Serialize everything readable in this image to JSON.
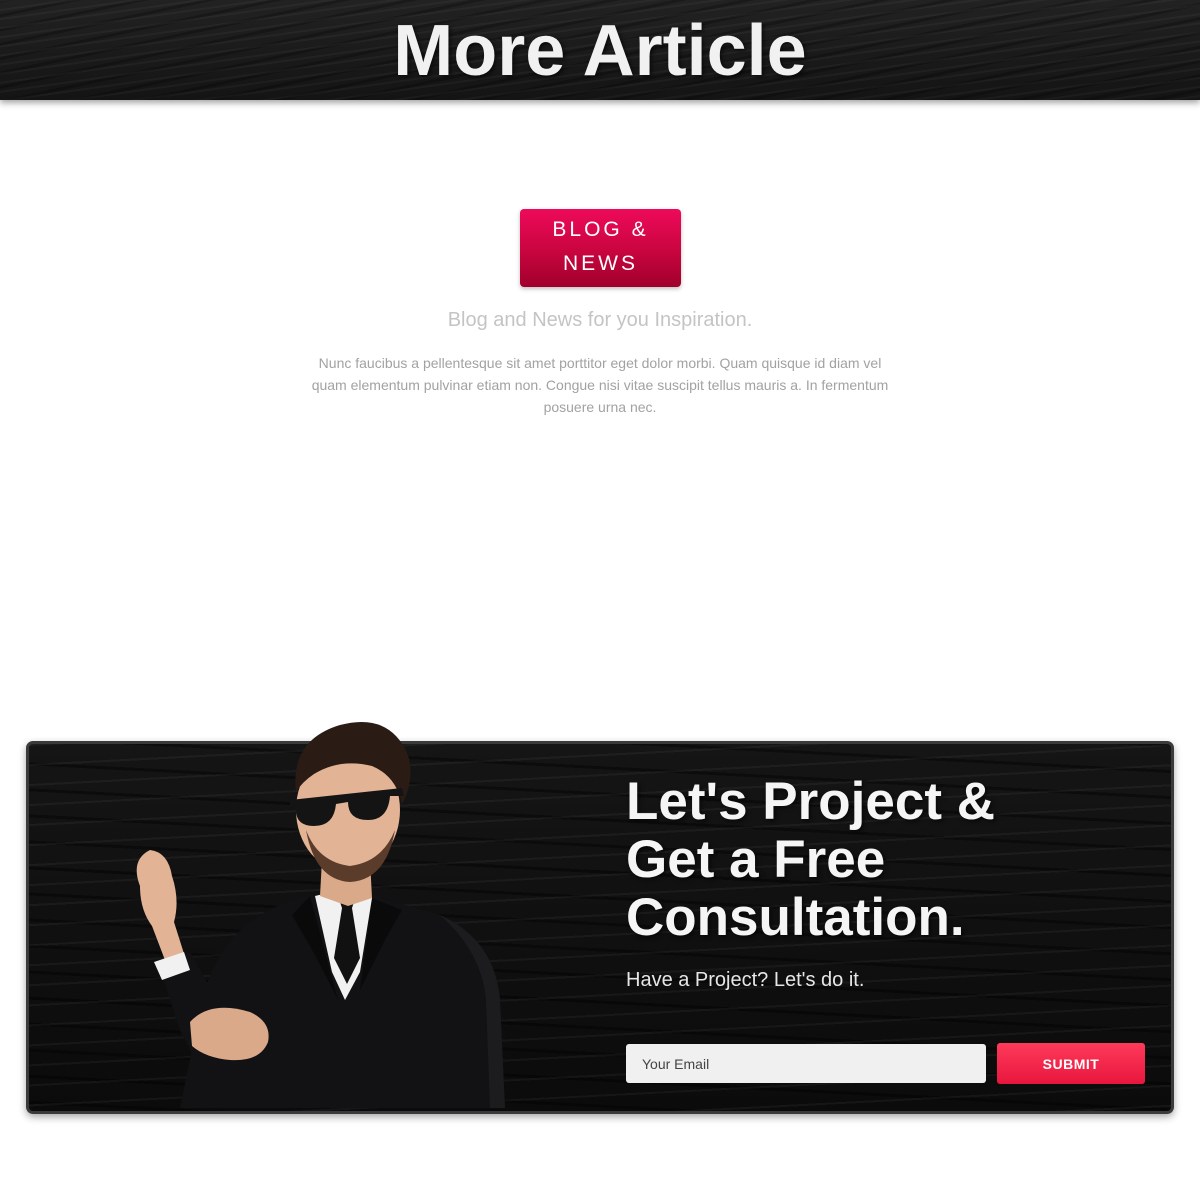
{
  "header": {
    "title": "More Article"
  },
  "blog_section": {
    "badge_line1": "BLOG &",
    "badge_line2": "NEWS",
    "subtitle": "Blog and News for you Inspiration.",
    "paragraph": "Nunc faucibus a pellentesque sit amet porttitor eget dolor morbi. Quam quisque id diam vel quam elementum pulvinar etiam non. Congue nisi vitae suscipit tellus mauris a. In fermentum posuere urna nec."
  },
  "cta": {
    "title_line1": "Let's Project &",
    "title_line2": "Get a Free",
    "title_line3": "Consultation.",
    "subtitle": "Have a Project? Let's do it.",
    "email_placeholder": "Your Email",
    "email_value": "",
    "submit_label": "SUBMIT",
    "image": "businessman-in-suit-and-sunglasses",
    "accent_color": "#e8163e"
  }
}
